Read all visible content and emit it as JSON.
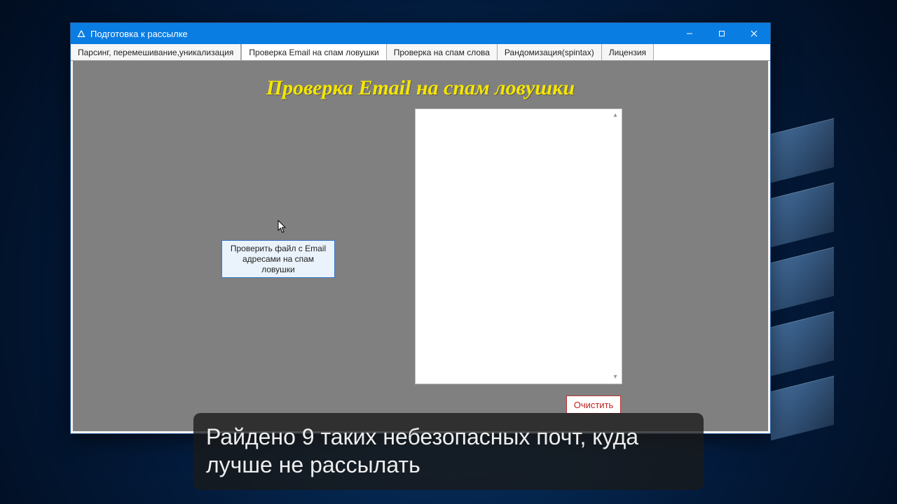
{
  "window": {
    "title": "Подготовка к рассылке"
  },
  "tabs": [
    {
      "label": "Парсинг, перемешивание,уникализация"
    },
    {
      "label": "Проверка Email на спам ловушки"
    },
    {
      "label": "Проверка на спам слова"
    },
    {
      "label": "Рандомизация(spintax)"
    },
    {
      "label": "Лицензия"
    }
  ],
  "page": {
    "title": "Проверка Email на спам ловушки",
    "check_button": "Проверить файл с Email адресами на спам ловушки",
    "clear_button": "Очистить"
  },
  "subtitle": "Райдено 9 таких небезопасных почт, куда лучше не рассылать"
}
